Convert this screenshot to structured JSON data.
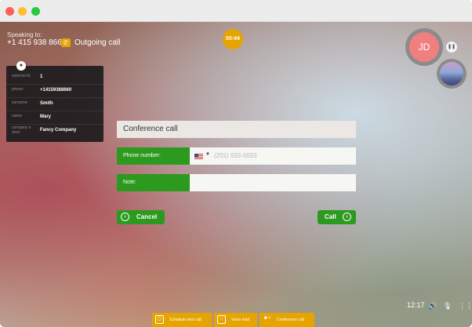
{
  "window": {
    "controls": [
      "close",
      "minimize",
      "maximize"
    ]
  },
  "call": {
    "speaking_label": "Speaking to:",
    "phone_number": "+1 415 938 8660",
    "status": "Outgoing call",
    "timer": "00:44"
  },
  "participants": {
    "avatar_initials": "JD",
    "avatar_color": "#f08080"
  },
  "contact_info": {
    "rows": [
      {
        "key": "external id:",
        "value": "1"
      },
      {
        "key": "phone:",
        "value": "+14159388660"
      },
      {
        "key": "surname:",
        "value": "Smith"
      },
      {
        "key": "name:",
        "value": "Mary"
      },
      {
        "key": "company n ame:",
        "value": "Fancy Company"
      }
    ]
  },
  "form": {
    "title": "Conference call",
    "phone_label": "Phone number:",
    "phone_placeholder": "(201) 555-5555",
    "note_label": "Note:",
    "note_value": ""
  },
  "buttons": {
    "cancel": "Cancel",
    "call": "Call"
  },
  "system": {
    "time": "12:17"
  },
  "bottom_actions": [
    {
      "label": "Schedule next call",
      "icon": "calendar-icon"
    },
    {
      "label": "Voice mail",
      "icon": "voicemail-icon"
    },
    {
      "label": "Conference call",
      "icon": "add-user-icon"
    }
  ],
  "colors": {
    "accent_green": "#2b9a1e",
    "accent_orange": "#e6a400"
  }
}
